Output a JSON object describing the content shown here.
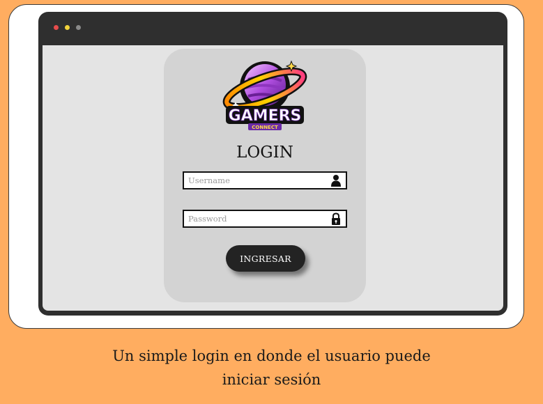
{
  "window": {
    "controls": [
      "close",
      "minimize",
      "maximize"
    ],
    "colors": {
      "close": "#e74c4c",
      "minimize": "#f2d33c",
      "maximize": "#8a8a8a"
    }
  },
  "logo": {
    "text": "GAMERS",
    "subtext": "CONNECT",
    "icon": "planet-logo-icon"
  },
  "login": {
    "title": "LOGIN",
    "username": {
      "placeholder": "Username",
      "value": "",
      "icon": "user-icon"
    },
    "password": {
      "placeholder": "Password",
      "value": "",
      "icon": "lock-icon"
    },
    "submit_label": "INGRESAR"
  },
  "caption": {
    "line1": "Un simple login en donde el usuario puede",
    "line2": "iniciar sesión"
  },
  "colors": {
    "page_background": "#FFAD60",
    "frame": "#2f2f2f",
    "panel": "#d3d3d3",
    "button": "#232323"
  }
}
